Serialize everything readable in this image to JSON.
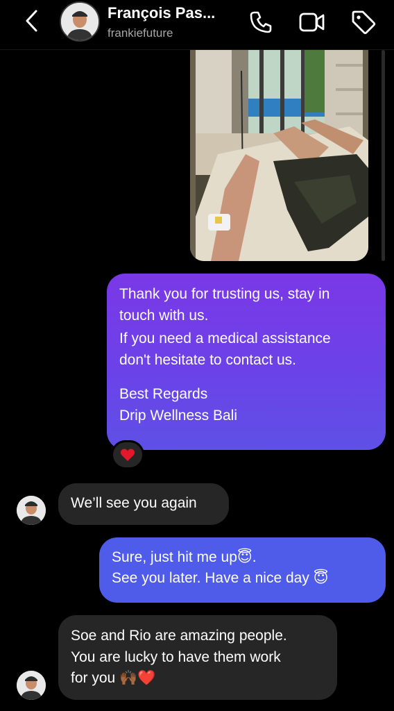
{
  "header": {
    "contact_name": "François Pas...",
    "username": "frankiefuture",
    "back_icon": "chevron-left-icon",
    "call_icon": "phone-icon",
    "video_icon": "video-camera-icon",
    "tag_icon": "tag-icon"
  },
  "messages": {
    "photo": {
      "description_icon": "shared-photo"
    },
    "outgoing_1": {
      "lines": [
        "Thank you for trusting us, stay in",
        "touch with us.",
        "If you need a medical assistance",
        "don't hesitate to contact us.",
        "",
        "Best Regards",
        "Drip Wellness Bali"
      ],
      "reaction": "❤️"
    },
    "incoming_1": {
      "text": "We’ll see you again"
    },
    "outgoing_2": {
      "line1": "Sure, just hit me up😇.",
      "line2": "See you later.  Have a nice day 😇"
    },
    "incoming_2": {
      "lines": [
        "Soe and Rio are amazing people.",
        "You are lucky to have them work",
        "for you 🙌🏾❤️"
      ]
    }
  },
  "colors": {
    "background": "#000000",
    "incoming_bubble": "#262626",
    "outgoing_gradient_top": "#7a38e6",
    "outgoing_gradient_bottom": "#5f50e6",
    "outgoing_bubble_blue": "#4f5cea",
    "secondary_text": "#a7a7a7"
  }
}
